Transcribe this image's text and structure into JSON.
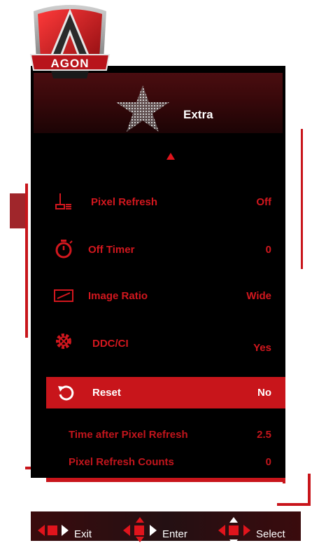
{
  "brand": {
    "logo_text": "AGON"
  },
  "menu": {
    "title": "Extra",
    "items": [
      {
        "label": "Pixel Refresh",
        "value": "Off",
        "icon": "pixel-refresh-icon"
      },
      {
        "label": "Off Timer",
        "value": "0",
        "icon": "timer-icon"
      },
      {
        "label": "Image Ratio",
        "value": "Wide",
        "icon": "image-ratio-icon"
      },
      {
        "label": "DDC/CI",
        "value": "Yes",
        "icon": "ddc-ci-gear-icon"
      },
      {
        "label": "Reset",
        "value": "No",
        "icon": "reset-icon",
        "selected": true
      }
    ],
    "info": [
      {
        "label": "Time after Pixel Refresh",
        "value": "2.5"
      },
      {
        "label": "Pixel Refresh Counts",
        "value": "0"
      }
    ]
  },
  "nav": {
    "exit": "Exit",
    "enter": "Enter",
    "select": "Select"
  },
  "colors": {
    "accent": "#c8151b",
    "panel": "#000000",
    "header": "#3a090b",
    "text_on_accent": "#ffffff"
  }
}
